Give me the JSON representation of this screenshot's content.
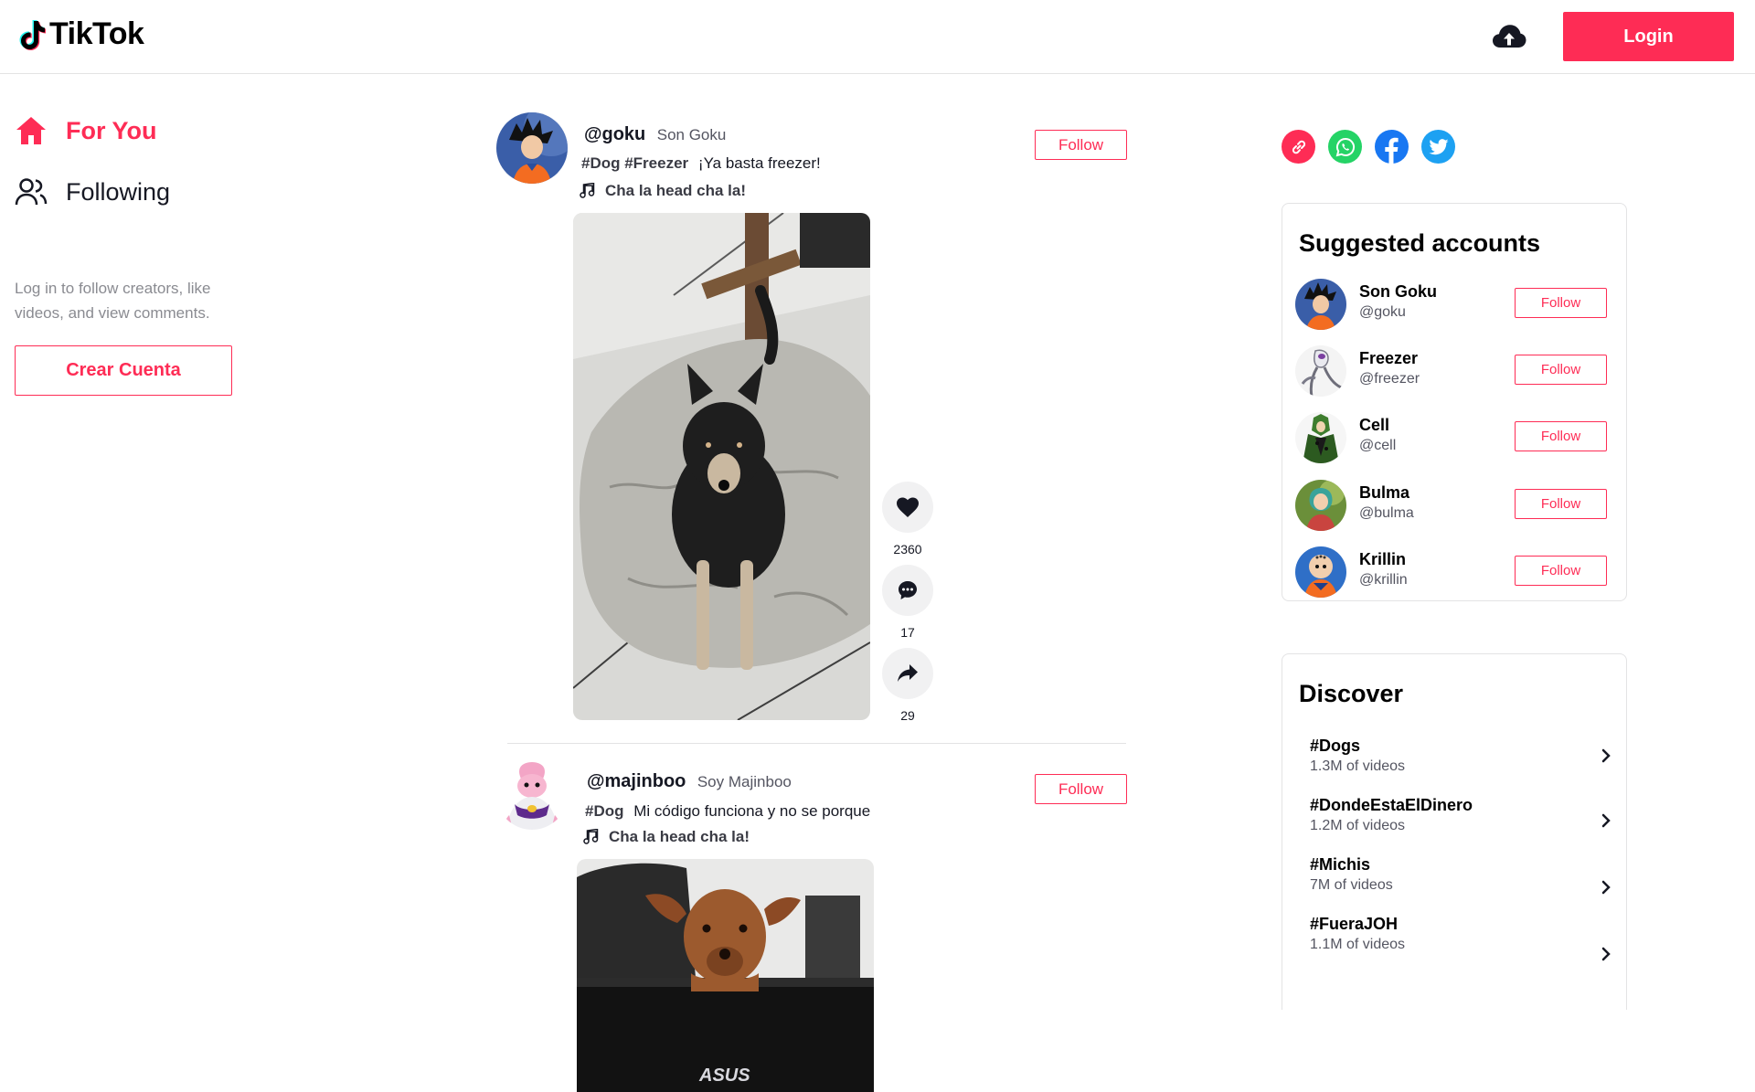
{
  "header": {
    "logo_text": "TikTok",
    "login_label": "Login",
    "upload_icon": "cloud-upload-icon"
  },
  "sidebar": {
    "nav": [
      {
        "label": "For You",
        "icon": "home-icon",
        "active": true
      },
      {
        "label": "Following",
        "icon": "users-icon",
        "active": false
      }
    ],
    "login_hint": "Log in to follow creators, like videos, and view comments.",
    "create_account_label": "Crear Cuenta"
  },
  "feed": [
    {
      "handle": "@goku",
      "display_name": "Son Goku",
      "tags": "#Dog #Freezer",
      "caption": "¡Ya basta freezer!",
      "music": "Cha la head cha la!",
      "follow_label": "Follow",
      "likes": "2360",
      "comments": "17",
      "shares": "29"
    },
    {
      "handle": "@majinboo",
      "display_name": "Soy Majinboo",
      "tags": "#Dog",
      "caption": "Mi código funciona y no se porque",
      "music": "Cha la head cha la!",
      "follow_label": "Follow",
      "video_brand_text": "ASUS"
    }
  ],
  "share_links": [
    {
      "name": "link-share-icon",
      "color": "#fe2c55"
    },
    {
      "name": "whatsapp-icon",
      "color": "#25d366"
    },
    {
      "name": "facebook-icon",
      "color": "#1877f2"
    },
    {
      "name": "twitter-icon",
      "color": "#1da1f2"
    }
  ],
  "suggested": {
    "title": "Suggested accounts",
    "accounts": [
      {
        "name": "Son Goku",
        "handle": "@goku",
        "follow_label": "Follow"
      },
      {
        "name": "Freezer",
        "handle": "@freezer",
        "follow_label": "Follow"
      },
      {
        "name": "Cell",
        "handle": "@cell",
        "follow_label": "Follow"
      },
      {
        "name": "Bulma",
        "handle": "@bulma",
        "follow_label": "Follow"
      },
      {
        "name": "Krillin",
        "handle": "@krillin",
        "follow_label": "Follow"
      }
    ]
  },
  "discover": {
    "title": "Discover",
    "items": [
      {
        "tag": "#Dogs",
        "count": "1.3M of videos"
      },
      {
        "tag": "#DondeEstaElDinero",
        "count": "1.2M of videos"
      },
      {
        "tag": "#Michis",
        "count": "7M of videos"
      },
      {
        "tag": "#FueraJOH",
        "count": "1.1M of videos"
      }
    ]
  },
  "colors": {
    "accent": "#fe2c55",
    "text": "#161823",
    "muted": "#8a8b91"
  }
}
